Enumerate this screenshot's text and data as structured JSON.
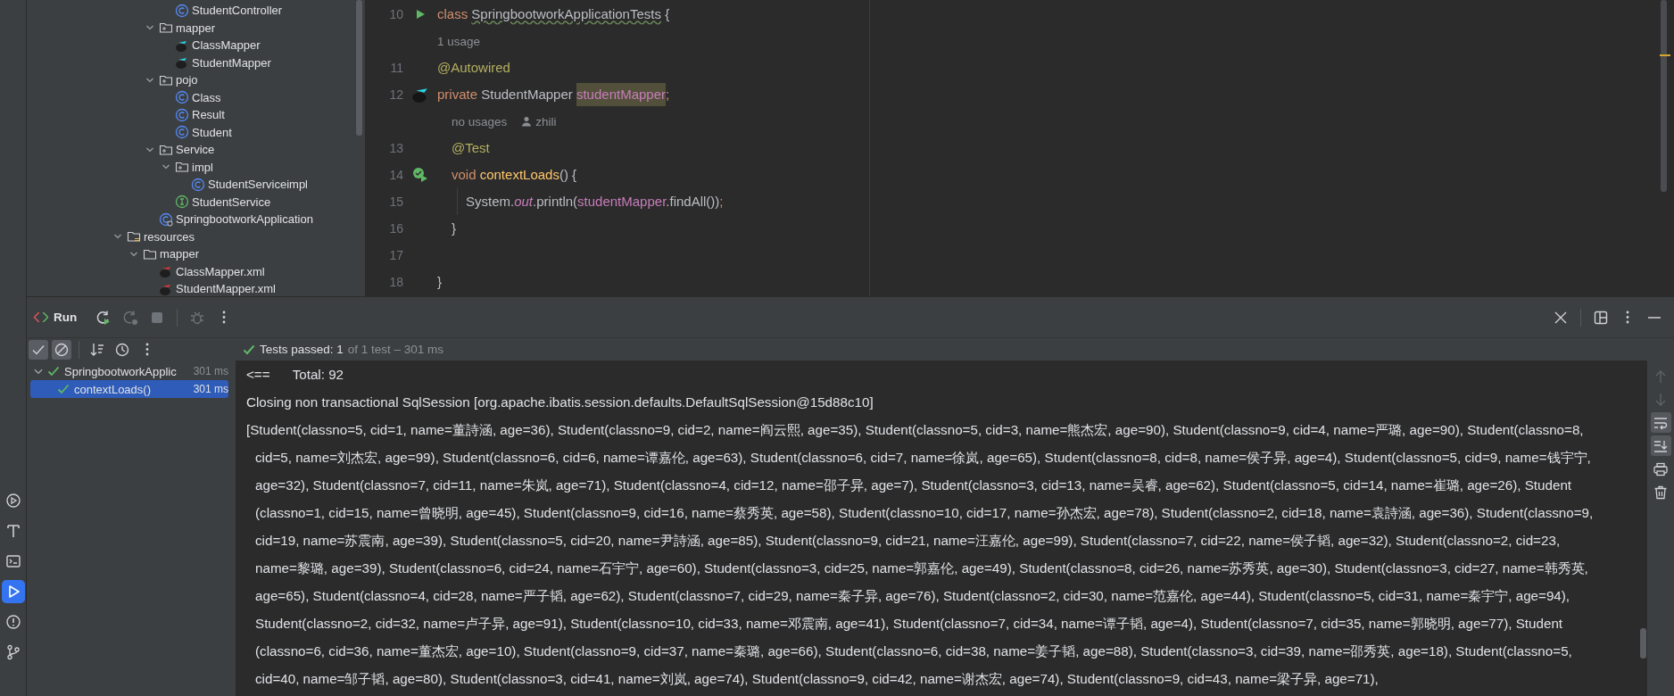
{
  "tool_strip": [
    {
      "kind": "services",
      "selected": false
    },
    {
      "kind": "build",
      "selected": false
    },
    {
      "kind": "terminal",
      "selected": false
    },
    {
      "kind": "run",
      "selected": true
    },
    {
      "kind": "problems",
      "selected": false
    },
    {
      "kind": "git",
      "selected": false
    }
  ],
  "project_tree": {
    "top_item": {
      "label": "StudentController",
      "kind": "class"
    },
    "package_contents": [
      {
        "label": "mapper",
        "kind": "package",
        "expanded": true,
        "children": [
          {
            "label": "ClassMapper",
            "kind": "mapper"
          },
          {
            "label": "StudentMapper",
            "kind": "mapper"
          }
        ]
      },
      {
        "label": "pojo",
        "kind": "package",
        "expanded": true,
        "children": [
          {
            "label": "Class",
            "kind": "class"
          },
          {
            "label": "Result",
            "kind": "class"
          },
          {
            "label": "Student",
            "kind": "class"
          }
        ]
      },
      {
        "label": "Service",
        "kind": "package",
        "expanded": true,
        "children": [
          {
            "label": "impl",
            "kind": "package",
            "expanded": true,
            "children": [
              {
                "label": "StudentServiceimpl",
                "kind": "class"
              }
            ]
          },
          {
            "label": "StudentService",
            "kind": "interface"
          }
        ]
      },
      {
        "label": "SpringbootworkApplication",
        "kind": "app"
      }
    ],
    "outer_items": [
      {
        "label": "resources",
        "kind": "resources",
        "expanded": true,
        "children": [
          {
            "label": "mapper",
            "kind": "folder",
            "expanded": true,
            "children": [
              {
                "label": "ClassMapper.xml",
                "kind": "xml"
              },
              {
                "label": "StudentMapper.xml",
                "kind": "xml"
              }
            ]
          }
        ]
      }
    ]
  },
  "editor": {
    "rows": [
      {
        "kind": "code",
        "number": "10",
        "block": {
          "kind": "class"
        },
        "gutter_icon": {
          "kind": "run"
        },
        "tokens": [
          {
            "text": "class ",
            "kind": "keyword"
          },
          {
            "text": "SpringbootworkApplicationTests",
            "kind": "type_warning"
          },
          {
            "text": " {",
            "kind": "plain"
          }
        ]
      },
      {
        "kind": "hint",
        "block": {
          "kind": "class"
        },
        "items": [
          {
            "text": "1 usage",
            "kind": "usages"
          }
        ]
      },
      {
        "kind": "code",
        "number": "11",
        "block": {
          "kind": "class"
        },
        "tokens": [
          {
            "text": "@Autowired",
            "kind": "annotation"
          }
        ]
      },
      {
        "kind": "code",
        "number": "12",
        "block": {
          "kind": "class"
        },
        "gutter_icon": {
          "kind": "bird"
        },
        "tokens": [
          {
            "text": "private ",
            "kind": "keyword"
          },
          {
            "text": "StudentMapper ",
            "kind": "plain"
          },
          {
            "text": "studentMapper",
            "kind": "field_selected"
          },
          {
            "text": ";",
            "kind": "keyword"
          }
        ]
      },
      {
        "kind": "hint",
        "block": {
          "kind": "method"
        },
        "items": [
          {
            "text": "no usages",
            "kind": "usages"
          },
          {
            "text": "zhili",
            "kind": "author"
          }
        ]
      },
      {
        "kind": "code",
        "number": "13",
        "block": {
          "kind": "method"
        },
        "tokens": [
          {
            "text": "@Test",
            "kind": "annotation"
          }
        ]
      },
      {
        "kind": "code",
        "number": "14",
        "block": {
          "kind": "method"
        },
        "gutter_icon": {
          "kind": "test_passed"
        },
        "tokens": [
          {
            "text": "void ",
            "kind": "keyword"
          },
          {
            "text": "contextLoads",
            "kind": "method"
          },
          {
            "text": "() {",
            "kind": "plain"
          }
        ]
      },
      {
        "kind": "code",
        "number": "15",
        "block": {
          "kind": "statement"
        },
        "tokens": [
          {
            "text": "System.",
            "kind": "plain"
          },
          {
            "text": "out",
            "kind": "static"
          },
          {
            "text": ".println(",
            "kind": "plain"
          },
          {
            "text": "studentMapper",
            "kind": "field"
          },
          {
            "text": ".findAll())",
            "kind": "plain"
          },
          {
            "text": ";",
            "kind": "keyword"
          }
        ]
      },
      {
        "kind": "code",
        "number": "16",
        "block": {
          "kind": "method"
        },
        "tokens": [
          {
            "text": "}",
            "kind": "plain"
          }
        ]
      },
      {
        "kind": "code",
        "number": "17",
        "block": {
          "kind": "class"
        },
        "tokens": []
      },
      {
        "kind": "code",
        "number": "18",
        "block": {
          "kind": "file"
        },
        "tokens": [
          {
            "text": "}",
            "kind": "plain"
          }
        ]
      }
    ]
  },
  "run_panel": {
    "title": "Run",
    "actions": [
      {
        "kind": "rerun",
        "disabled": false
      },
      {
        "kind": "rerun_failed",
        "disabled": true
      },
      {
        "kind": "stop",
        "disabled": true
      },
      {
        "kind": "debug",
        "disabled": true
      },
      {
        "kind": "more",
        "disabled": false
      }
    ],
    "window_actions": [
      {
        "kind": "close"
      },
      {
        "kind": "layout"
      },
      {
        "kind": "more"
      },
      {
        "kind": "minimize"
      }
    ],
    "filters": [
      {
        "kind": "passed",
        "selected": true
      },
      {
        "kind": "ignored",
        "selected": true
      }
    ],
    "tools": [
      {
        "kind": "sort"
      },
      {
        "kind": "history"
      },
      {
        "kind": "more"
      }
    ],
    "status": {
      "passed": "Tests passed: 1",
      "detail": "of 1 test – 301 ms"
    },
    "tests": [
      {
        "label": "SpringbootworkApplic",
        "time": "301 ms",
        "passed": true,
        "expanded": true,
        "selected": false,
        "children": [
          {
            "label": "contextLoads()",
            "time": "301 ms",
            "passed": true,
            "selected": true
          }
        ]
      }
    ],
    "console": [
      {
        "kind": "line",
        "text": "<==      Total: 92"
      },
      {
        "kind": "line",
        "text": "Closing non transactional SqlSession [org.apache.ibatis.session.defaults.DefaultSqlSession@15d88c10]"
      },
      {
        "kind": "line",
        "text": "[Student(classno=5, cid=1, name=董詩涵, age=36), Student(classno=9, cid=2, name=阎云熙, age=35), Student(classno=5, cid=3, name=熊杰宏, age=90), Student(classno=9, cid=4, name=严璐, age=90), Student(classno=8,"
      },
      {
        "kind": "wrap",
        "text": "cid=5, name=刘杰宏, age=99), Student(classno=6, cid=6, name=谭嘉伦, age=63), Student(classno=6, cid=7, name=徐岚, age=65), Student(classno=8, cid=8, name=侯子异, age=4), Student(classno=5, cid=9, name=钱宇宁,"
      },
      {
        "kind": "wrap",
        "text": "age=32), Student(classno=7, cid=11, name=朱岚, age=71), Student(classno=4, cid=12, name=邵子异, age=7), Student(classno=3, cid=13, name=吴睿, age=62), Student(classno=5, cid=14, name=崔璐, age=26), Student"
      },
      {
        "kind": "wrap",
        "text": "(classno=1, cid=15, name=曾晓明, age=45), Student(classno=9, cid=16, name=蔡秀英, age=58), Student(classno=10, cid=17, name=孙杰宏, age=78), Student(classno=2, cid=18, name=袁詩涵, age=36), Student(classno=9,"
      },
      {
        "kind": "wrap",
        "text": "cid=19, name=苏震南, age=39), Student(classno=5, cid=20, name=尹詩涵, age=85), Student(classno=9, cid=21, name=汪嘉伦, age=99), Student(classno=7, cid=22, name=侯子韬, age=32), Student(classno=2, cid=23,"
      },
      {
        "kind": "wrap",
        "text": "name=黎璐, age=39), Student(classno=6, cid=24, name=石宇宁, age=60), Student(classno=3, cid=25, name=郭嘉伦, age=49), Student(classno=8, cid=26, name=苏秀英, age=30), Student(classno=3, cid=27, name=韩秀英,"
      },
      {
        "kind": "wrap",
        "text": "age=65), Student(classno=4, cid=28, name=严子韬, age=62), Student(classno=7, cid=29, name=秦子异, age=76), Student(classno=2, cid=30, name=范嘉伦, age=44), Student(classno=5, cid=31, name=秦宇宁, age=94),"
      },
      {
        "kind": "wrap",
        "text": "Student(classno=2, cid=32, name=卢子异, age=91), Student(classno=10, cid=33, name=邓震南, age=41), Student(classno=7, cid=34, name=谭子韬, age=4), Student(classno=7, cid=35, name=郭晓明, age=77), Student"
      },
      {
        "kind": "wrap",
        "text": "(classno=6, cid=36, name=董杰宏, age=10), Student(classno=9, cid=37, name=秦璐, age=66), Student(classno=6, cid=38, name=姜子韬, age=88), Student(classno=3, cid=39, name=邵秀英, age=18), Student(classno=5,"
      },
      {
        "kind": "wrap",
        "text": "cid=40, name=邹子韬, age=80), Student(classno=3, cid=41, name=刘岚, age=74), Student(classno=9, cid=42, name=谢杰宏, age=74), Student(classno=9, cid=43, name=梁子异, age=71),"
      }
    ],
    "console_actions": [
      {
        "kind": "up",
        "disabled": true
      },
      {
        "kind": "down",
        "disabled": true
      },
      {
        "kind": "wrap",
        "on": true
      },
      {
        "kind": "scroll_end",
        "on": true
      },
      {
        "kind": "print"
      },
      {
        "kind": "clear"
      }
    ]
  }
}
